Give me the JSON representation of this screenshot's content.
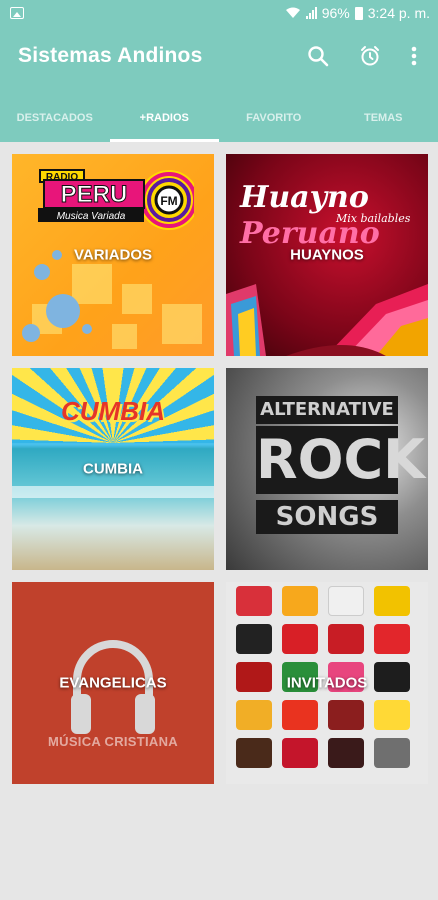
{
  "status_bar": {
    "battery": "96%",
    "time": "3:24 p. m."
  },
  "app_bar": {
    "title": "Sistemas Andinos",
    "actions": [
      "search-icon",
      "alarm-icon",
      "more-vert-icon"
    ]
  },
  "tabs": [
    {
      "label": "DESTACADOS",
      "active": false
    },
    {
      "label": "+RADIOS",
      "active": true
    },
    {
      "label": "FAVORITO",
      "active": false
    },
    {
      "label": "TEMAS",
      "active": false
    }
  ],
  "colors": {
    "primary": "#7ecbbe",
    "background": "#e6e6e6",
    "evangelicas": "#c0412c"
  },
  "tiles": [
    {
      "label": "VARIADOS",
      "logo": {
        "radio": "RADIO",
        "peru": "PERU",
        "variada": "Musica Variada",
        "fm": "FM"
      }
    },
    {
      "label": "HUAYNOS",
      "art": {
        "huayno": "Huayno",
        "mix": "Mix bailables",
        "peruano": "Peruano"
      }
    },
    {
      "label": "CUMBIA",
      "art": {
        "cumbia": "CUMBIA"
      }
    },
    {
      "label": "ROCK",
      "art": {
        "alternative": "ALTERNATIVE",
        "rock": "ROCK",
        "songs": "SONGS"
      }
    },
    {
      "label": "EVANGELICAS",
      "subtitle": "MÚSICA CRISTIANA"
    },
    {
      "label": "INVITADOS"
    }
  ]
}
